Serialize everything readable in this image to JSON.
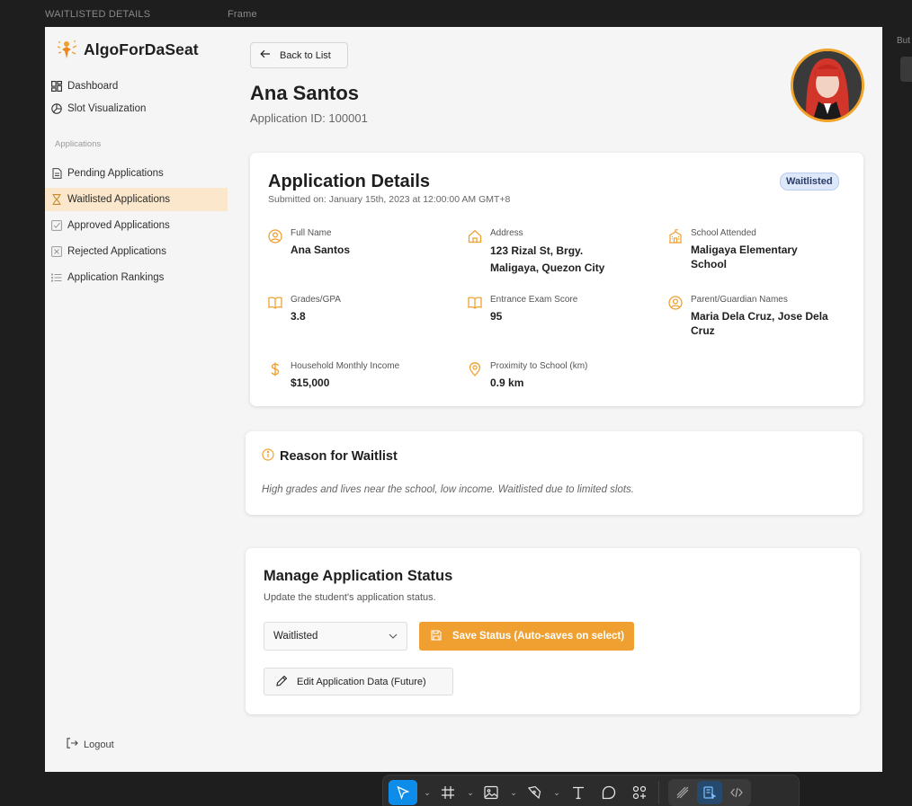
{
  "canvas": {
    "frame_label_left": "WAITLISTED DETAILS",
    "frame_label_right": "Frame",
    "side_label": "But"
  },
  "sidebar": {
    "brand": "AlgoForDaSeat",
    "items_top": [
      {
        "label": "Dashboard",
        "icon": "dashboard-icon"
      },
      {
        "label": "Slot Visualization",
        "icon": "pie-chart-icon"
      }
    ],
    "section_label": "Applications",
    "items_apps": [
      {
        "label": "Pending Applications",
        "icon": "file-icon"
      },
      {
        "label": "Waitlisted Applications",
        "icon": "hourglass-icon",
        "active": true
      },
      {
        "label": "Approved Applications",
        "icon": "check-square-icon"
      },
      {
        "label": "Rejected Applications",
        "icon": "x-square-icon"
      },
      {
        "label": "Application Rankings",
        "icon": "list-icon"
      }
    ],
    "logout": "Logout"
  },
  "header": {
    "back_label": "Back to List",
    "name": "Ana Santos",
    "app_id": "Application ID: 100001"
  },
  "details": {
    "title": "Application Details",
    "submitted": "Submitted on: January 15th, 2023 at 12:00:00 AM GMT+8",
    "status": "Waitlisted",
    "fields": [
      {
        "label": "Full Name",
        "value": "Ana Santos",
        "icon": "user-circle-icon"
      },
      {
        "label": "Address",
        "value": "123 Rizal St, Brgy.\n Maligaya, Quezon City",
        "icon": "home-icon"
      },
      {
        "label": "School Attended",
        "value": "Maligaya Elementary\nSchool",
        "icon": "school-icon"
      },
      {
        "label": "Grades/GPA",
        "value": "3.8",
        "icon": "book-icon"
      },
      {
        "label": "Entrance Exam Score",
        "value": "95",
        "icon": "book-icon"
      },
      {
        "label": "Parent/Guardian Names",
        "value": "Maria Dela Cruz, Jose Dela\nCruz",
        "icon": "user-circle-icon"
      },
      {
        "label": "Household Monthly Income",
        "value": "$15,000",
        "icon": "dollar-icon"
      },
      {
        "label": "Proximity to School (km)",
        "value": "0.9 km",
        "icon": "map-pin-icon"
      }
    ]
  },
  "reason": {
    "title": "Reason for Waitlist",
    "text": "High grades and lives near the school, low income. Waitlisted due to limited slots."
  },
  "manage": {
    "title": "Manage Application Status",
    "subtitle": "Update the student's application status.",
    "select_value": "Waitlisted",
    "save_label": "Save Status (Auto-saves on select)",
    "edit_label": "Edit Application Data (Future)"
  },
  "colors": {
    "accent": "#f0a030",
    "active_bg": "#fbe8cc",
    "badge_bg": "#dde8fb"
  }
}
